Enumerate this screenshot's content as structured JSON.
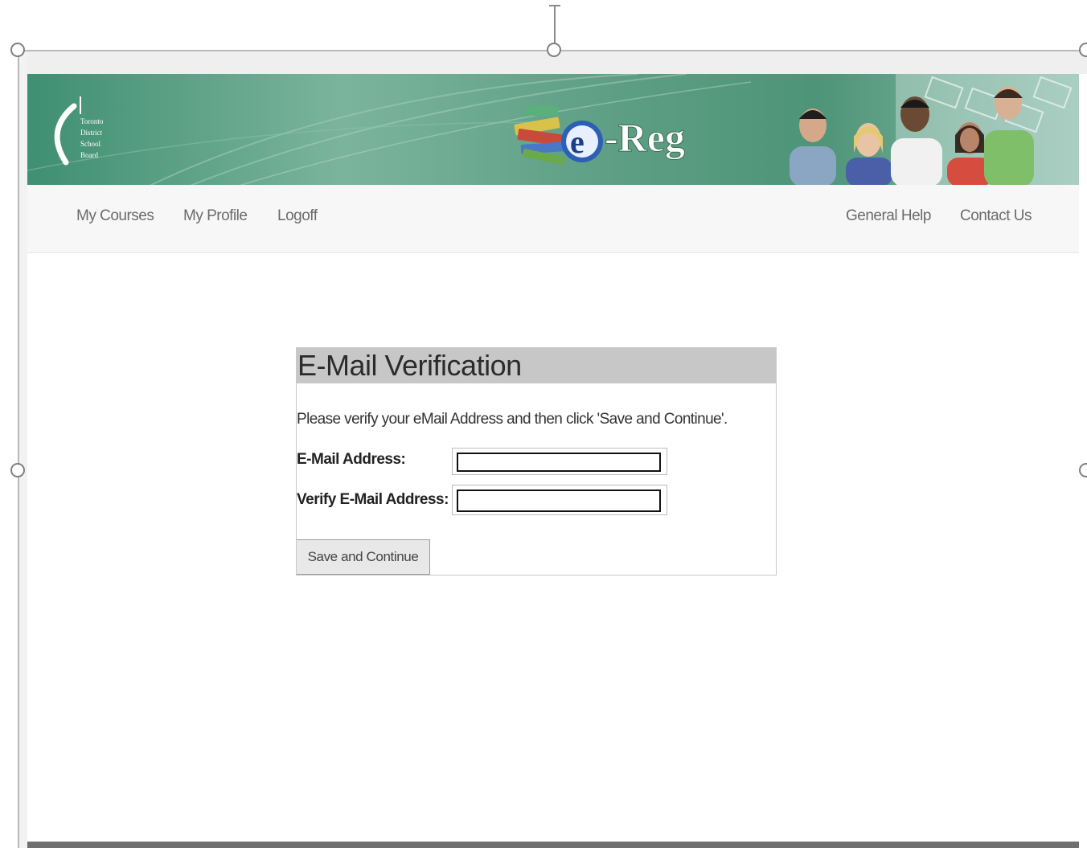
{
  "banner": {
    "logo_lines": [
      "Toronto",
      "District",
      "School",
      "Board"
    ],
    "brand_prefix": "e",
    "brand_suffix": "-Reg"
  },
  "nav": {
    "left": [
      "My Courses",
      "My Profile",
      "Logoff"
    ],
    "right": [
      "General Help",
      "Contact Us"
    ]
  },
  "form": {
    "title": "E-Mail Verification",
    "intro": "Please verify your eMail Address and then click 'Save and Continue'.",
    "email_label": "E-Mail Address:",
    "email_value": "",
    "verify_label": "Verify E-Mail Address:",
    "verify_value": "",
    "submit_label": "Save and Continue"
  },
  "colors": {
    "banner_green": "#4d9478",
    "panel_header": "#c7c7c7"
  }
}
